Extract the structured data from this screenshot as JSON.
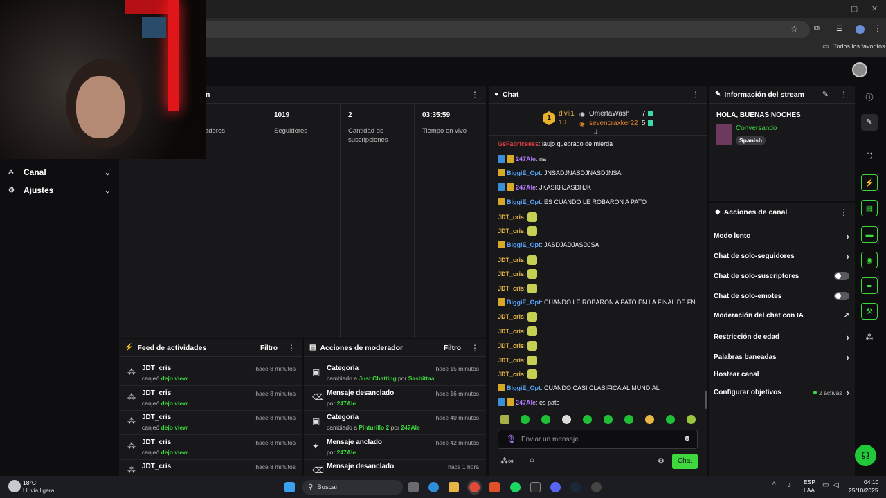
{
  "browser": {
    "bookmarks_label": "Todos los favoritos"
  },
  "sidebar": {
    "items": [
      {
        "label": "Canal"
      },
      {
        "label": "Ajustes"
      }
    ]
  },
  "stats": {
    "header_label": "n",
    "columns": [
      {
        "value": "",
        "label": "pectadores"
      },
      {
        "value": "1019",
        "label": "Seguidores"
      },
      {
        "value": "2",
        "label": "Cantidad de suscripciones"
      },
      {
        "value": "03:35:59",
        "label": "Tiempo en vivo"
      }
    ]
  },
  "activity": {
    "title": "Feed de actividades",
    "filter_label": "Filtro",
    "items": [
      {
        "name": "JDT_cris",
        "prefix": "canjeó",
        "action": "dejo view",
        "time": "hace 8 minutos"
      },
      {
        "name": "JDT_cris",
        "prefix": "canjeó",
        "action": "dejo view",
        "time": "hace 8 minutos"
      },
      {
        "name": "JDT_cris",
        "prefix": "canjeó",
        "action": "dejo view",
        "time": "hace 8 minutos"
      },
      {
        "name": "JDT_cris",
        "prefix": "canjeó",
        "action": "dejo view",
        "time": "hace 8 minutos"
      },
      {
        "name": "JDT_cris",
        "prefix": "",
        "action": "",
        "time": "hace 8 minutos"
      }
    ]
  },
  "modactions": {
    "title": "Acciones de moderador",
    "filter_label": "Filtro",
    "items": [
      {
        "title": "Categoría",
        "pre": "cambiado a",
        "val": "Just Chatting",
        "mid": "por",
        "user": "Sashittaa",
        "time": "hace 15 minutos"
      },
      {
        "title": "Mensaje desanclado",
        "pre": "por",
        "val": "247Ale",
        "mid": "",
        "user": "",
        "time": "hace 16 minutos"
      },
      {
        "title": "Categoría",
        "pre": "cambiado a",
        "val": "Pinturillo 2",
        "mid": "por",
        "user": "247Ale",
        "time": "hace 40 minutos"
      },
      {
        "title": "Mensaje anclado",
        "pre": "por",
        "val": "247Ale",
        "mid": "",
        "user": "",
        "time": "hace 42 minutos"
      },
      {
        "title": "Mensaje desanclado",
        "pre": "",
        "val": "",
        "mid": "",
        "user": "",
        "time": "hace 1 hora"
      }
    ]
  },
  "chat": {
    "title": "Chat",
    "leaderboard": {
      "first_name": "divii1",
      "first_count": "10",
      "second_name": "OmertaWash",
      "second_count": "7",
      "third_name": "sevencraxker22",
      "third_count": "5",
      "rank": "1"
    },
    "messages": [
      {
        "user": "GsFabriceess",
        "text": ": laujo quebrado de mierda"
      },
      {
        "user": "247Ale",
        "text": ": na"
      },
      {
        "user": "BiggiE_Opt",
        "text": ": JNSADJNASDJNASDJNSA"
      },
      {
        "user": "247Ale",
        "text": ": JKASKHJASDHJK"
      },
      {
        "user": "BiggiE_Opt",
        "text": ": ES CUANDO LE ROBARON A PATO"
      },
      {
        "user": "JDT_cris",
        "text": ":"
      },
      {
        "user": "JDT_cris",
        "text": ":"
      },
      {
        "user": "BiggiE_Opt",
        "text": ": JASDJADJASDJSA"
      },
      {
        "user": "JDT_cris",
        "text": ":"
      },
      {
        "user": "JDT_cris",
        "text": ":"
      },
      {
        "user": "JDT_cris",
        "text": ":"
      },
      {
        "user": "BiggiE_Opt",
        "text": ": CUANDO LE ROBARON A PATO EN LA FINAL DE FN"
      },
      {
        "user": "JDT_cris",
        "text": ":"
      },
      {
        "user": "JDT_cris",
        "text": ":"
      },
      {
        "user": "JDT_cris",
        "text": ":"
      },
      {
        "user": "JDT_cris",
        "text": ":"
      },
      {
        "user": "JDT_cris",
        "text": ":"
      },
      {
        "user": "BiggiE_Opt",
        "text": ": CUANDO CASI CLASIFICA AL MUNDIAL"
      },
      {
        "user": "247Ale",
        "text": ": es pato"
      }
    ],
    "input_placeholder": "Enviar un mensaje",
    "send_label": "Chat"
  },
  "streaminfo": {
    "title": "Información del stream",
    "stream_title": "HOLA, BUENAS NOCHES",
    "category": "Conversando",
    "language": "Spanish"
  },
  "chanactions": {
    "title": "Acciones de canal",
    "items": [
      {
        "label": "Modo lento"
      },
      {
        "label": "Chat de solo-seguidores"
      },
      {
        "label": "Chat de solo-suscriptores"
      },
      {
        "label": "Chat de solo-emotes"
      },
      {
        "label": "Moderación del chat con IA"
      },
      {
        "label": "Restricción de edad"
      },
      {
        "label": "Palabras baneadas"
      },
      {
        "label": "Hostear canal"
      },
      {
        "label": "Configurar objetivos"
      }
    ],
    "goals_status": "2 activas"
  },
  "taskbar": {
    "weather_temp": "18°C",
    "weather_desc": "Lluvia ligera",
    "search_label": "Buscar",
    "lang_top": "ESP",
    "lang_bottom": "LAA",
    "time": "04:10",
    "date": "25/10/2025"
  }
}
